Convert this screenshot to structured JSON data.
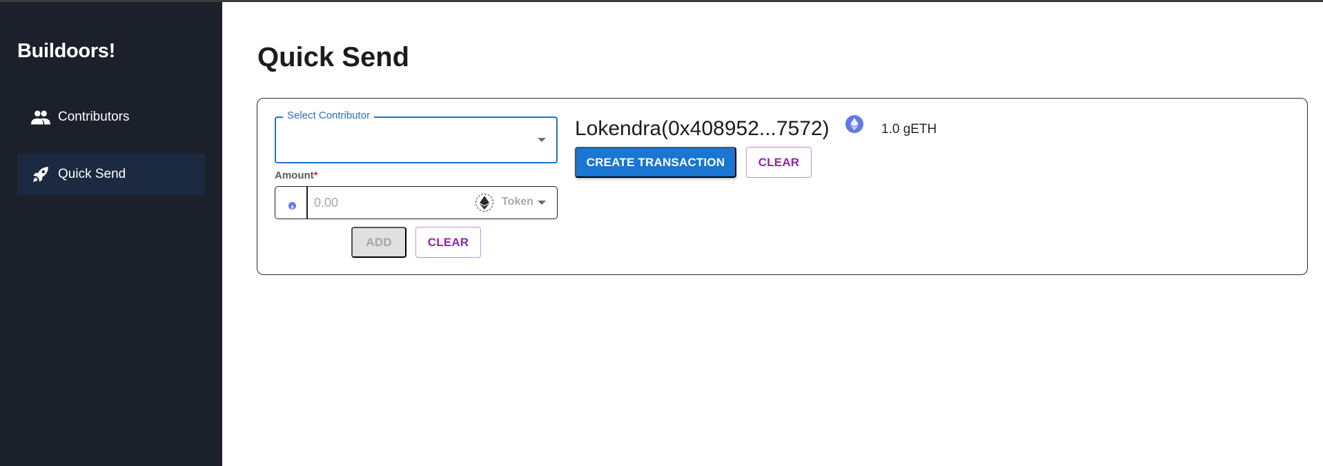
{
  "app": {
    "brand": "Buildoors!"
  },
  "sidebar": {
    "items": [
      {
        "label": "Contributors",
        "icon": "people-icon",
        "active": false
      },
      {
        "label": "Quick Send",
        "icon": "rocket-icon",
        "active": true
      }
    ]
  },
  "page": {
    "title": "Quick Send"
  },
  "form": {
    "select_contributor": {
      "label": "Select Contributor",
      "value": ""
    },
    "amount": {
      "label": "Amount",
      "required_mark": "*",
      "placeholder": "0.00",
      "value": "",
      "token_label": "Token"
    },
    "add_label": "ADD",
    "clear_label": "CLEAR"
  },
  "transaction": {
    "recipient": "Lokendra(0x408952...7572)",
    "balance": "1.0 gETH",
    "create_label": "CREATE TRANSACTION",
    "clear_label": "CLEAR"
  },
  "colors": {
    "sidebar_bg": "#1c202b",
    "sidebar_active_bg": "#1b2a40",
    "primary": "#1976d2",
    "secondary": "#8e24aa",
    "eth": "#6279e8",
    "required": "#d32f2f"
  }
}
